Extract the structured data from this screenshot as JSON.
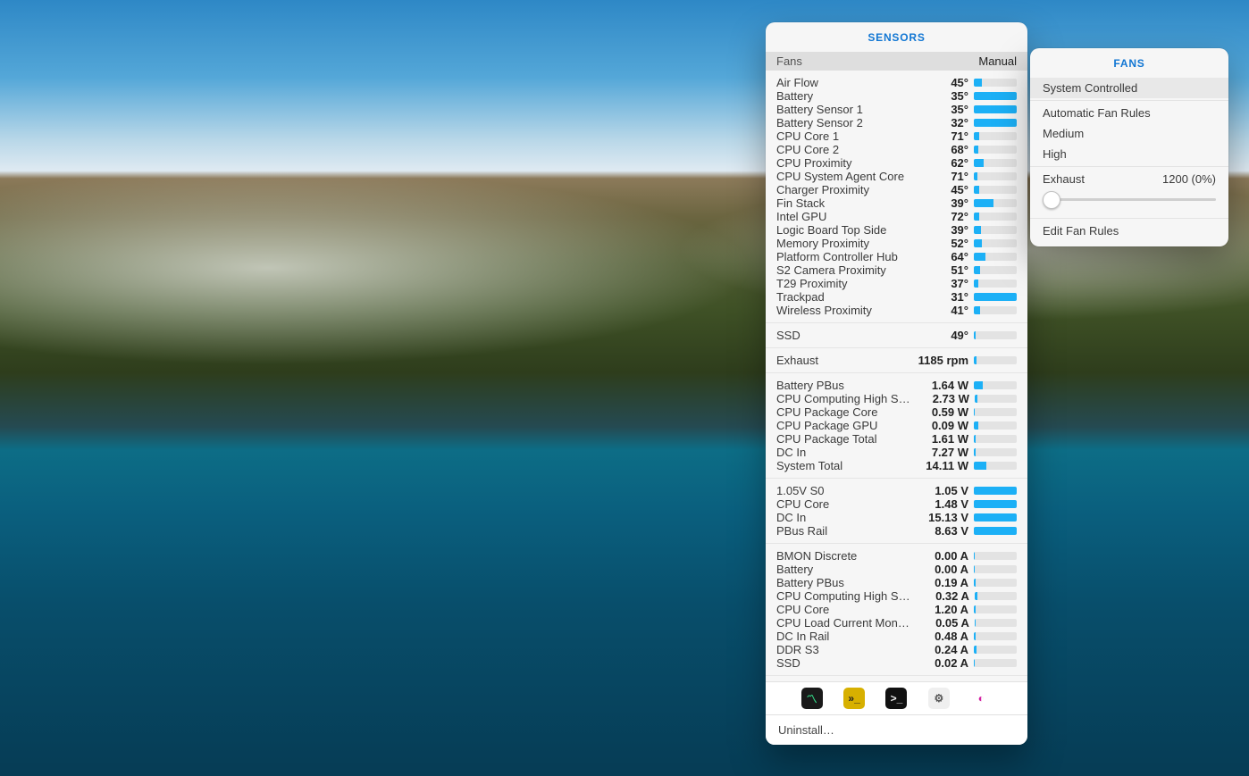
{
  "sensorsPanel": {
    "title": "SENSORS",
    "header": {
      "left": "Fans",
      "right": "Manual"
    },
    "groups": [
      {
        "unit": "°",
        "rows": [
          {
            "name": "Air Flow",
            "v": 45,
            "pct": 18
          },
          {
            "name": "Battery",
            "v": 35,
            "pct": 100
          },
          {
            "name": "Battery Sensor 1",
            "v": 35,
            "pct": 100
          },
          {
            "name": "Battery Sensor 2",
            "v": 32,
            "pct": 100
          },
          {
            "name": "CPU Core 1",
            "v": 71,
            "pct": 12
          },
          {
            "name": "CPU Core 2",
            "v": 68,
            "pct": 10
          },
          {
            "name": "CPU Proximity",
            "v": 62,
            "pct": 22
          },
          {
            "name": "CPU System Agent Core",
            "v": 71,
            "pct": 8
          },
          {
            "name": "Charger Proximity",
            "v": 45,
            "pct": 12
          },
          {
            "name": "Fin Stack",
            "v": 39,
            "pct": 45
          },
          {
            "name": "Intel GPU",
            "v": 72,
            "pct": 12
          },
          {
            "name": "Logic Board Top Side",
            "v": 39,
            "pct": 16
          },
          {
            "name": "Memory Proximity",
            "v": 52,
            "pct": 18
          },
          {
            "name": "Platform Controller Hub",
            "v": 64,
            "pct": 28
          },
          {
            "name": "S2 Camera Proximity",
            "v": 51,
            "pct": 14
          },
          {
            "name": "T29 Proximity",
            "v": 37,
            "pct": 10
          },
          {
            "name": "Trackpad",
            "v": 31,
            "pct": 100
          },
          {
            "name": "Wireless Proximity",
            "v": 41,
            "pct": 14
          }
        ]
      },
      {
        "unit": "°",
        "rows": [
          {
            "name": "SSD",
            "v": 49,
            "pct": 4
          }
        ]
      },
      {
        "unit": " rpm",
        "rows": [
          {
            "name": "Exhaust",
            "v": 1185,
            "pct": 6
          }
        ]
      },
      {
        "unit": " W",
        "rows": [
          {
            "name": "Battery PBus",
            "v": "1.64",
            "pct": 20
          },
          {
            "name": "CPU Computing High Side",
            "v": "2.73",
            "pct": 6
          },
          {
            "name": "CPU Package Core",
            "v": "0.59",
            "pct": 3
          },
          {
            "name": "CPU Package GPU",
            "v": "0.09",
            "pct": 10
          },
          {
            "name": "CPU Package Total",
            "v": "1.61",
            "pct": 5
          },
          {
            "name": "DC In",
            "v": "7.27",
            "pct": 4
          },
          {
            "name": "System Total",
            "v": "14.11",
            "pct": 30
          }
        ]
      },
      {
        "unit": " V",
        "rows": [
          {
            "name": "1.05V S0",
            "v": "1.05",
            "pct": 100
          },
          {
            "name": "CPU Core",
            "v": "1.48",
            "pct": 100
          },
          {
            "name": "DC In",
            "v": "15.13",
            "pct": 100
          },
          {
            "name": "PBus Rail",
            "v": "8.63",
            "pct": 100
          }
        ]
      },
      {
        "unit": " A",
        "rows": [
          {
            "name": "BMON Discrete",
            "v": "0.00",
            "pct": 2
          },
          {
            "name": "Battery",
            "v": "0.00",
            "pct": 2
          },
          {
            "name": "Battery PBus",
            "v": "0.19",
            "pct": 4
          },
          {
            "name": "CPU Computing High Side",
            "v": "0.32",
            "pct": 6
          },
          {
            "name": "CPU Core",
            "v": "1.20",
            "pct": 4
          },
          {
            "name": "CPU Load Current Monitor",
            "v": "0.05",
            "pct": 3
          },
          {
            "name": "DC In Rail",
            "v": "0.48",
            "pct": 4
          },
          {
            "name": "DDR S3",
            "v": "0.24",
            "pct": 6
          },
          {
            "name": "SSD",
            "v": "0.02",
            "pct": 3
          }
        ]
      }
    ],
    "apps": [
      {
        "id": "activity-monitor",
        "bg": "#1a1a1a",
        "sym": "〽︎",
        "fg": "#35e08b"
      },
      {
        "id": "console",
        "bg": "#d7b000",
        "sym": "»_",
        "fg": "#222"
      },
      {
        "id": "terminal",
        "bg": "#111",
        "sym": ">_",
        "fg": "#eee"
      },
      {
        "id": "system-information",
        "bg": "#efefef",
        "sym": "⚙︎",
        "fg": "#555"
      },
      {
        "id": "speedtest",
        "bg": "#fff",
        "sym": "◐",
        "fg": "#d21ea0"
      }
    ],
    "footer": "Uninstall…"
  },
  "fansPanel": {
    "title": "FANS",
    "options": [
      {
        "label": "System Controlled",
        "selected": true
      },
      {
        "label": "Automatic Fan Rules"
      },
      {
        "label": "Medium"
      },
      {
        "label": "High"
      }
    ],
    "fan": {
      "name": "Exhaust",
      "readout": "1200 (0%)",
      "pos": 0
    },
    "edit": "Edit Fan Rules"
  }
}
